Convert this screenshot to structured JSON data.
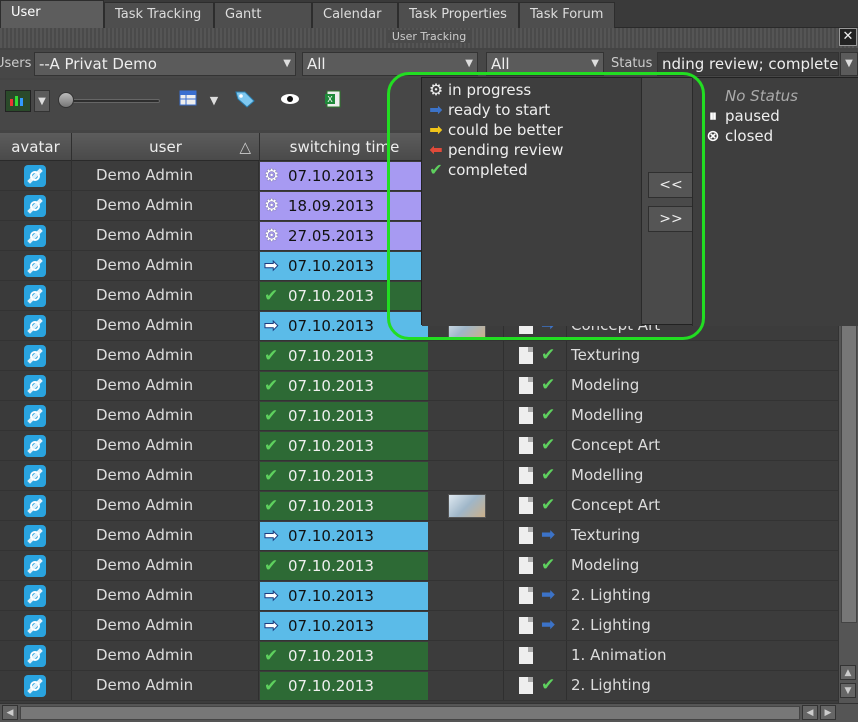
{
  "tabs": [
    {
      "label": "User Tracking",
      "active": true
    },
    {
      "label": "Task Tracking"
    },
    {
      "label": "Gantt Chart"
    },
    {
      "label": "Calendar"
    },
    {
      "label": "Task Properties"
    },
    {
      "label": "Task Forum"
    }
  ],
  "panel_title": "User Tracking",
  "filters": {
    "users_label": "Users",
    "users_value": "--A Privat Demo",
    "filter2_value": "All",
    "filter3_value": "All",
    "status_label": "Status",
    "status_value": "nding review; completed"
  },
  "columns": {
    "avatar": "avatar",
    "user": "user",
    "switching_time": "switching time"
  },
  "rows": [
    {
      "user": "Demo Admin",
      "date": "07.10.2013",
      "time_status": "in progress",
      "task": ""
    },
    {
      "user": "Demo Admin",
      "date": "18.09.2013",
      "time_status": "in progress",
      "task": ""
    },
    {
      "user": "Demo Admin",
      "date": "27.05.2013",
      "time_status": "in progress",
      "task": ""
    },
    {
      "user": "Demo Admin",
      "date": "07.10.2013",
      "time_status": "ready to start",
      "task": ""
    },
    {
      "user": "Demo Admin",
      "date": "07.10.2013",
      "time_status": "completed",
      "task": ""
    },
    {
      "user": "Demo Admin",
      "date": "07.10.2013",
      "time_status": "ready to start",
      "task": "Concept Art",
      "task_status": "ready to start",
      "thumb": true
    },
    {
      "user": "Demo Admin",
      "date": "07.10.2013",
      "time_status": "completed",
      "task": "Texturing",
      "task_status": "completed"
    },
    {
      "user": "Demo Admin",
      "date": "07.10.2013",
      "time_status": "completed",
      "task": "Modeling",
      "task_status": "completed"
    },
    {
      "user": "Demo Admin",
      "date": "07.10.2013",
      "time_status": "completed",
      "task": "Modelling",
      "task_status": "completed"
    },
    {
      "user": "Demo Admin",
      "date": "07.10.2013",
      "time_status": "completed",
      "task": "Concept Art",
      "task_status": "completed"
    },
    {
      "user": "Demo Admin",
      "date": "07.10.2013",
      "time_status": "completed",
      "task": "Modelling",
      "task_status": "completed"
    },
    {
      "user": "Demo Admin",
      "date": "07.10.2013",
      "time_status": "completed",
      "task": "Concept Art",
      "task_status": "completed",
      "thumb": true
    },
    {
      "user": "Demo Admin",
      "date": "07.10.2013",
      "time_status": "ready to start",
      "task": "Texturing",
      "task_status": "ready to start"
    },
    {
      "user": "Demo Admin",
      "date": "07.10.2013",
      "time_status": "completed",
      "task": "Modeling",
      "task_status": "completed"
    },
    {
      "user": "Demo Admin",
      "date": "07.10.2013",
      "time_status": "ready to start",
      "task": "2. Lighting",
      "task_status": "ready to start"
    },
    {
      "user": "Demo Admin",
      "date": "07.10.2013",
      "time_status": "ready to start",
      "task": "2. Lighting",
      "task_status": "ready to start"
    },
    {
      "user": "Demo Admin",
      "date": "07.10.2013",
      "time_status": "completed",
      "task": "1. Animation",
      "task_status": ""
    },
    {
      "user": "Demo Admin",
      "date": "07.10.2013",
      "time_status": "completed",
      "task": "2. Lighting",
      "task_status": "completed"
    }
  ],
  "status_popup": {
    "selected": [
      {
        "label": "in progress",
        "icon": "gear-icon"
      },
      {
        "label": "ready to start",
        "icon": "arrow-right-icon"
      },
      {
        "label": "could be better",
        "icon": "arrow-yellow-icon"
      },
      {
        "label": "pending review",
        "icon": "arrow-left-red-icon"
      },
      {
        "label": "completed",
        "icon": "check-icon"
      }
    ],
    "available": [
      {
        "label": "No Status",
        "icon": "",
        "dim": true
      },
      {
        "label": "paused",
        "icon": "pause-icon"
      },
      {
        "label": "closed",
        "icon": "closed-icon"
      }
    ],
    "add_label": "<<",
    "remove_label": ">>"
  },
  "colors": {
    "in_progress": "#a79af2",
    "ready_to_start": "#5bbbe8",
    "completed": "#2d6a35",
    "highlight": "#22dd22"
  }
}
